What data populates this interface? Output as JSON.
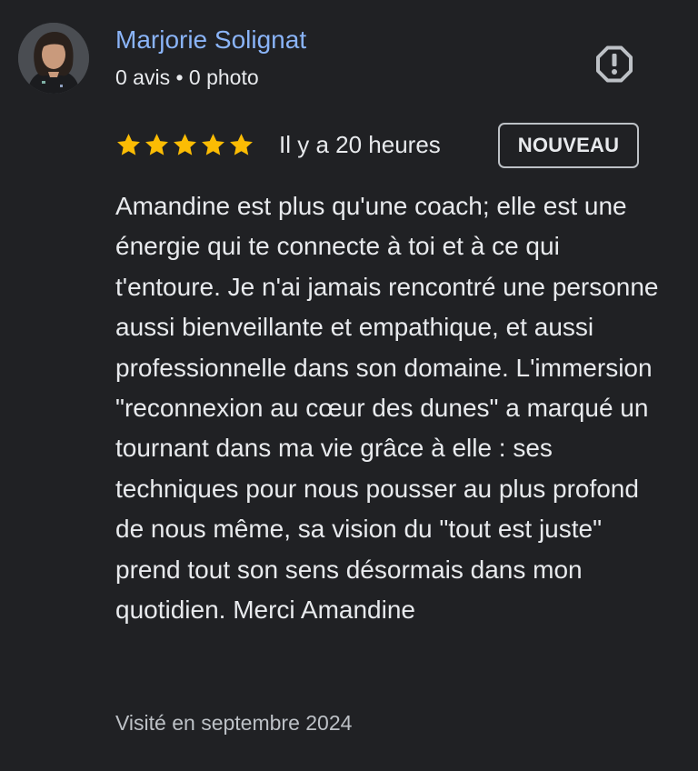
{
  "author": {
    "name": "Marjorie Solignat",
    "meta": "0 avis • 0 photo",
    "avatar_icon": "user-avatar-photo"
  },
  "report": {
    "icon": "report-flag-icon"
  },
  "rating": {
    "stars": 5,
    "max_stars": 5,
    "star_color": "#fbbc04",
    "time_ago": "Il y a 20 heures",
    "badge": "NOUVEAU"
  },
  "review": {
    "text": "Amandine est plus qu'une coach; elle est une énergie qui te connecte à toi et à ce qui t'entoure. Je n'ai jamais rencontré une personne aussi bienveillante et empathique, et aussi professionnelle dans son domaine. L'immersion \"reconnexion au cœur des dunes\" a marqué un tournant dans ma vie grâce à elle : ses techniques pour nous pousser au plus profond de nous même, sa vision du \"tout est juste\" prend tout son sens désormais dans mon quotidien. Merci Amandine",
    "visit": "Visité en septembre 2024"
  },
  "colors": {
    "background": "#202124",
    "name_link": "#8ab4f8",
    "text": "#e8eaed",
    "muted": "#bdc1c6"
  }
}
